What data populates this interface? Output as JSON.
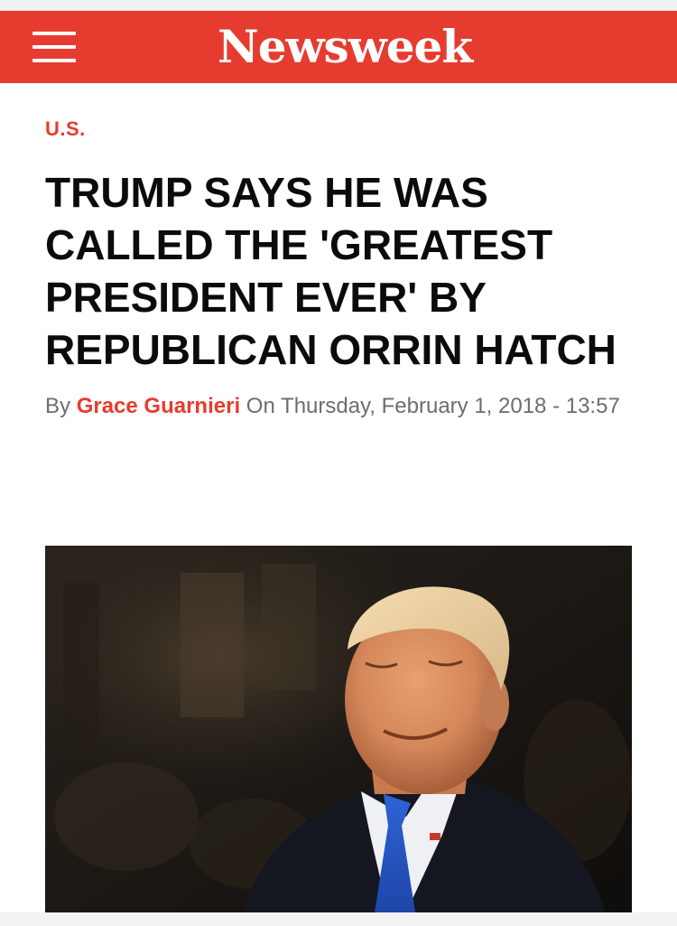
{
  "header": {
    "brand": "Newsweek",
    "brand_color": "#e63c2f",
    "menu_icon": "hamburger-menu-icon"
  },
  "article": {
    "section": "U.S.",
    "headline": "Trump Says He Was Called the 'Greatest President Ever' by Republican Orrin Hatch",
    "byline_prefix": "By ",
    "author": "Grace Guarnieri",
    "date_text": " On Thursday, February 1, 2018 - 13:57"
  }
}
